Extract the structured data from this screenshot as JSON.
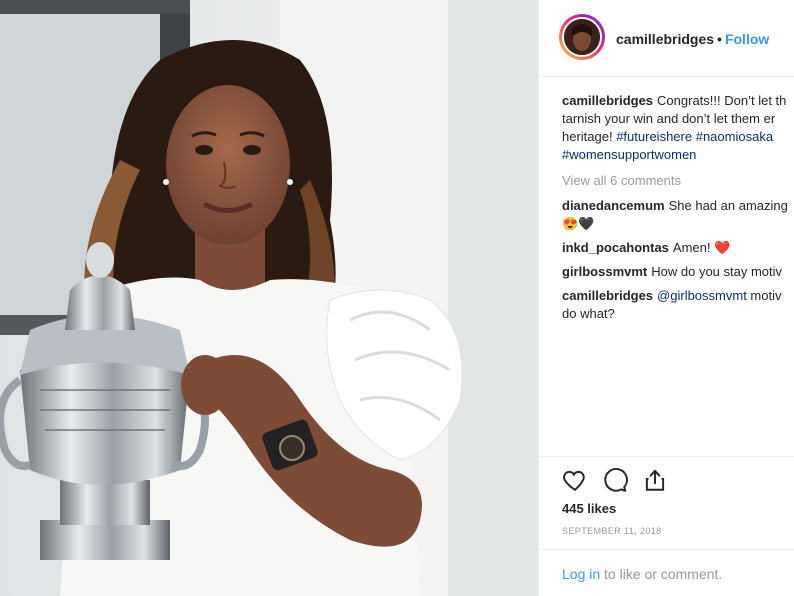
{
  "post": {
    "username": "camillebridges",
    "follow_label": "Follow",
    "separator": "•"
  },
  "caption": {
    "username": "camillebridges",
    "line1_text": "Congrats!!! Don’t let th",
    "line2_text": "tarnish your win and don’t let them er",
    "line3_prefix": "heritage! ",
    "hashtag1": "#futureishere",
    "hashtag2": "#naomiosaka",
    "hashtag3": "#womensupportwomen"
  },
  "view_all": "View all 6 comments",
  "comments": [
    {
      "username": "dianedancemum",
      "text": "She had an amazing",
      "text2": "😍🖤"
    },
    {
      "username": "inkd_pocahontas",
      "text": "Amen! ❤️"
    },
    {
      "username": "girlbossmvmt",
      "text": "How do you stay motiv"
    },
    {
      "username": "camillebridges",
      "mention": "@girlbossmvmt",
      "text": " motiv",
      "text2": "do what?"
    }
  ],
  "likes": "445 likes",
  "date": "SEPTEMBER 11, 2018",
  "login": {
    "link": "Log in",
    "rest": " to like or comment."
  },
  "icons": [
    "heart-icon",
    "comment-icon",
    "share-icon"
  ],
  "colors": {
    "link_blue": "#3897f0",
    "hashtag": "#003569",
    "muted": "#999999",
    "text": "#262626"
  }
}
